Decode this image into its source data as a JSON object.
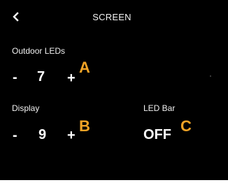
{
  "header": {
    "back_icon": "chevron-left-icon",
    "title": "SCREEN"
  },
  "outdoor_leds": {
    "label": "Outdoor LEDs",
    "decrement": "-",
    "value": "7",
    "increment": "+",
    "callout": "A"
  },
  "display": {
    "label": "Display",
    "decrement": "-",
    "value": "9",
    "increment": "+",
    "callout": "B"
  },
  "led_bar": {
    "label": "LED Bar",
    "value": "OFF",
    "callout": "C"
  },
  "colors": {
    "background": "#000000",
    "text": "#ffffff",
    "callout": "#f0a326"
  }
}
